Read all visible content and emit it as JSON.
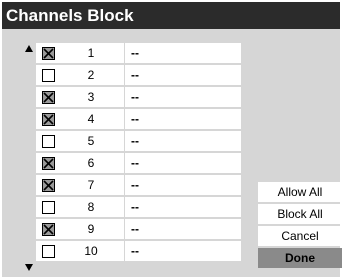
{
  "title": "Channels Block",
  "channels": [
    {
      "number": "1",
      "name": "--",
      "checked": true
    },
    {
      "number": "2",
      "name": "--",
      "checked": false
    },
    {
      "number": "3",
      "name": "--",
      "checked": true
    },
    {
      "number": "4",
      "name": "--",
      "checked": true
    },
    {
      "number": "5",
      "name": "--",
      "checked": false
    },
    {
      "number": "6",
      "name": "--",
      "checked": true
    },
    {
      "number": "7",
      "name": "--",
      "checked": true
    },
    {
      "number": "8",
      "name": "--",
      "checked": false
    },
    {
      "number": "9",
      "name": "--",
      "checked": true
    },
    {
      "number": "10",
      "name": "--",
      "checked": false
    }
  ],
  "buttons": {
    "allow_all": "Allow All",
    "block_all": "Block All",
    "cancel": "Cancel",
    "done": "Done"
  },
  "icons": {
    "scroll_up": "triangle-up-icon",
    "scroll_down": "triangle-down-icon",
    "checkbox_checked": "checkbox-checked-icon"
  }
}
